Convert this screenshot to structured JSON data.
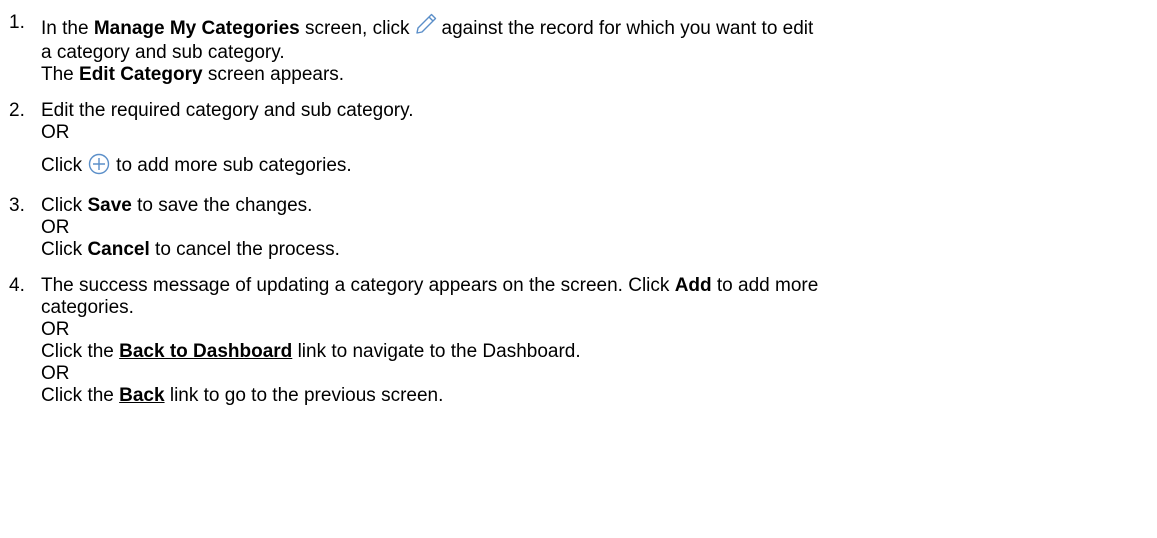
{
  "steps": [
    {
      "num": "1.",
      "line1_pre": "In the",
      "line1_bold": "Manage My Categories",
      "line1_mid": "screen, click",
      "line1_post": "against the record for which you want to edit",
      "line2": "a category and sub category.",
      "line3_pre": "The",
      "line3_bold": "Edit Category",
      "line3_post": "screen appears.",
      "icon": "pencil-icon"
    },
    {
      "num": "2.",
      "line1": "Edit the required category and sub category.",
      "or": "OR",
      "line3_pre": "Click",
      "line3_post": "to add more sub categories.",
      "icon": "add-circle-icon"
    },
    {
      "num": "3.",
      "line1_pre": "Click",
      "line1_bold": "Save",
      "line1_post": "to save the changes.",
      "or": "OR",
      "line3_pre": "Click",
      "line3_bold": "Cancel",
      "line3_post": "to cancel the process."
    },
    {
      "num": "4.",
      "line1_pre": "The success message of updating a category appears on the screen. Click",
      "line1_bold": "Add",
      "line1_post": "to add more",
      "line2": "categories.",
      "or1": "OR",
      "line4_pre": "Click the",
      "line4_link": "Back to Dashboard",
      "line4_post": "link to navigate to the Dashboard.",
      "or2": "OR",
      "line6_pre": "Click the",
      "line6_link": "Back",
      "line6_post": "link to go to the previous screen."
    }
  ],
  "colors": {
    "icon": "#5b8fc9",
    "text": "#000000"
  }
}
